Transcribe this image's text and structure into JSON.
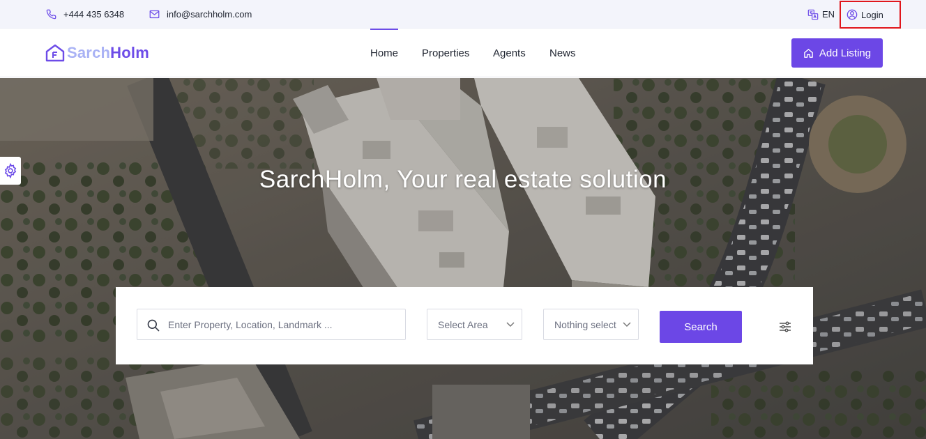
{
  "topbar": {
    "phone": "+444 435 6348",
    "email": "info@sarchholm.com",
    "language": "EN",
    "login_label": "Login",
    "icons": {
      "phone": "phone-icon",
      "email": "mail-icon",
      "language": "translate-icon",
      "login": "user-circle-icon"
    }
  },
  "header": {
    "logo": {
      "part1": "Sarch",
      "part2": "Holm"
    },
    "nav": [
      {
        "label": "Home",
        "active": true
      },
      {
        "label": "Properties",
        "active": false
      },
      {
        "label": "Agents",
        "active": false
      },
      {
        "label": "News",
        "active": false
      }
    ],
    "add_listing_label": "Add Listing"
  },
  "hero": {
    "title": "SarchHolm, Your real estate solution"
  },
  "search": {
    "keyword_placeholder": "Enter Property, Location, Landmark ...",
    "area_select": "Select Area",
    "type_select": "Nothing select",
    "button_label": "Search"
  },
  "colors": {
    "accent": "#6c47e6",
    "logo_light": "#a9b2f5",
    "topbar_bg": "#f3f4fb",
    "highlight": "#e0161c"
  }
}
